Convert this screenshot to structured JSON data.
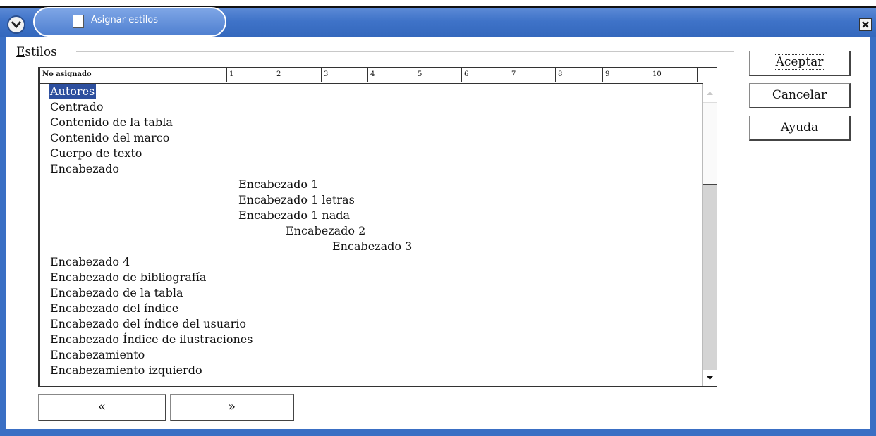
{
  "window": {
    "title": "Asignar estilos"
  },
  "group": {
    "label": "Estilos"
  },
  "columns": [
    "No asignado",
    "1",
    "2",
    "3",
    "4",
    "5",
    "6",
    "7",
    "8",
    "9",
    "10"
  ],
  "styles": [
    {
      "name": "Autores",
      "level": 0,
      "selected": true
    },
    {
      "name": "Centrado",
      "level": 0
    },
    {
      "name": "Contenido de la tabla",
      "level": 0
    },
    {
      "name": "Contenido del marco",
      "level": 0
    },
    {
      "name": "Cuerpo de texto",
      "level": 0
    },
    {
      "name": "Encabezado",
      "level": 0
    },
    {
      "name": "Encabezado 1",
      "level": 1
    },
    {
      "name": "Encabezado 1 letras",
      "level": 1
    },
    {
      "name": "Encabezado 1 nada",
      "level": 1
    },
    {
      "name": "Encabezado 2",
      "level": 2
    },
    {
      "name": "Encabezado 3",
      "level": 3
    },
    {
      "name": "Encabezado 4",
      "level": 0
    },
    {
      "name": "Encabezado de bibliografía",
      "level": 0
    },
    {
      "name": "Encabezado de la tabla",
      "level": 0
    },
    {
      "name": "Encabezado del índice",
      "level": 0
    },
    {
      "name": "Encabezado del índice del usuario",
      "level": 0
    },
    {
      "name": "Encabezado Índice de ilustraciones",
      "level": 0
    },
    {
      "name": "Encabezamiento",
      "level": 0
    },
    {
      "name": "Encabezamiento izquierdo",
      "level": 0
    }
  ],
  "buttons": {
    "accept": "Aceptar",
    "cancel": "Cancelar",
    "help": "Ayuda",
    "prev": "«",
    "next": "»"
  },
  "icons": {
    "menu": "chevron-down-icon",
    "document": "document-icon",
    "close": "close-icon",
    "scroll_up": "arrow-up-icon",
    "scroll_down": "arrow-down-icon"
  },
  "colors": {
    "title_blue": "#3f73c8",
    "selection": "#2d4f9e"
  }
}
